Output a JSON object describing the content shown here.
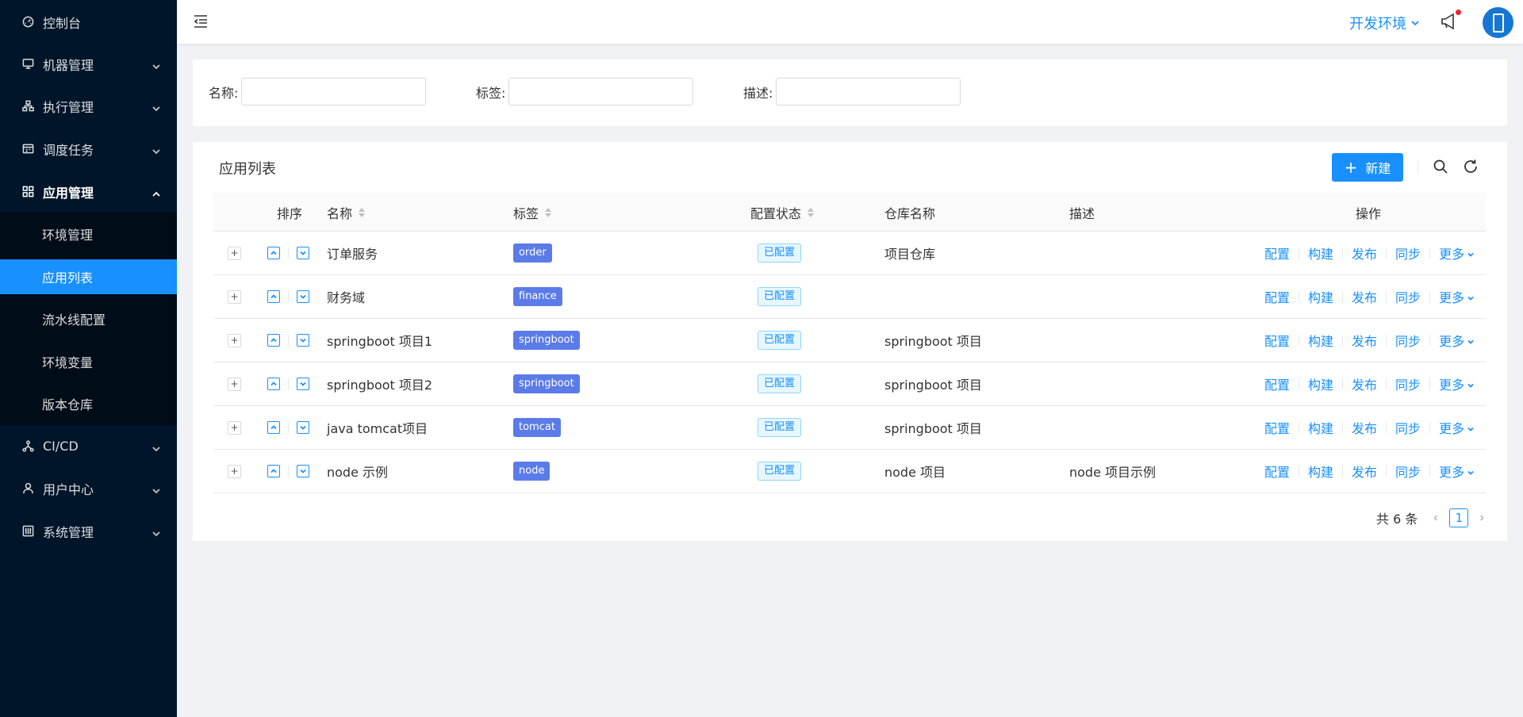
{
  "sidebar": {
    "menu": [
      {
        "label": "控制台",
        "icon": "dashboard-icon"
      },
      {
        "label": "机器管理",
        "icon": "desktop-icon"
      },
      {
        "label": "执行管理",
        "icon": "cluster-icon"
      },
      {
        "label": "调度任务",
        "icon": "schedule-icon"
      },
      {
        "label": "应用管理",
        "icon": "appstore-icon"
      },
      {
        "label": "CI/CD",
        "icon": "branches-icon"
      },
      {
        "label": "用户中心",
        "icon": "user-icon"
      },
      {
        "label": "系统管理",
        "icon": "setting-icon"
      }
    ],
    "submenu": [
      {
        "label": "环境管理"
      },
      {
        "label": "应用列表"
      },
      {
        "label": "流水线配置"
      },
      {
        "label": "环境变量"
      },
      {
        "label": "版本仓库"
      }
    ]
  },
  "header": {
    "env": "开发环境"
  },
  "search": {
    "name_label": "名称:",
    "tag_label": "标签:",
    "desc_label": "描述:"
  },
  "list": {
    "title": "应用列表",
    "new_button": "新建",
    "columns": {
      "sort": "排序",
      "name": "名称",
      "tag": "标签",
      "status": "配置状态",
      "repo": "仓库名称",
      "desc": "描述",
      "ops": "操作"
    },
    "rows": [
      {
        "name": "订单服务",
        "tag": "order",
        "status": "已配置",
        "repo": "项目仓库",
        "desc": ""
      },
      {
        "name": "财务域",
        "tag": "finance",
        "status": "已配置",
        "repo": "",
        "desc": ""
      },
      {
        "name": "springboot 项目1",
        "tag": "springboot",
        "status": "已配置",
        "repo": "springboot 项目",
        "desc": ""
      },
      {
        "name": "springboot 项目2",
        "tag": "springboot",
        "status": "已配置",
        "repo": "springboot 项目",
        "desc": ""
      },
      {
        "name": "java tomcat项目",
        "tag": "tomcat",
        "status": "已配置",
        "repo": "springboot 项目",
        "desc": ""
      },
      {
        "name": "node 示例",
        "tag": "node",
        "status": "已配置",
        "repo": "node 项目",
        "desc": "node 项目示例"
      }
    ],
    "ops": {
      "config": "配置",
      "build": "构建",
      "release": "发布",
      "sync": "同步",
      "more": "更多"
    }
  },
  "pagination": {
    "total_text": "共 6 条",
    "current_page": "1"
  },
  "colors": {
    "sidebar_bg": "#001529",
    "submenu_bg": "#000c17",
    "accent": "#1890ff",
    "tag_bg": "#5b7be8"
  }
}
